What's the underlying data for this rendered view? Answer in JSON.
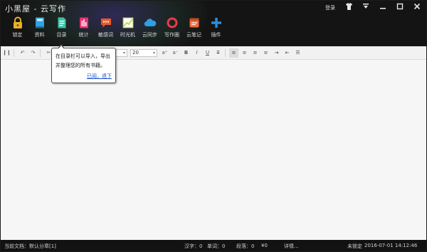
{
  "app": {
    "title": "小黑屋 - 云写作",
    "login_label": "登录"
  },
  "window_controls": [
    "shirt-icon",
    "minimize-icon",
    "restore-icon",
    "close-icon"
  ],
  "ribbon": [
    {
      "id": "lock",
      "label": "锁定",
      "icon": "lock-icon",
      "color": "#e8b12b"
    },
    {
      "id": "material",
      "label": "资料",
      "icon": "book-icon",
      "color": "#2fa3e0"
    },
    {
      "id": "catalog",
      "label": "目录",
      "icon": "document-icon",
      "color": "#3cc1a2"
    },
    {
      "id": "stats",
      "label": "统计",
      "icon": "stats-icon",
      "color": "#e8336e"
    },
    {
      "id": "sensitive",
      "label": "敏感词",
      "icon": "chat-icon",
      "color": "#e8592b"
    },
    {
      "id": "timemachine",
      "label": "时光机",
      "icon": "chart-icon",
      "color": "#b7d33a"
    },
    {
      "id": "cloudsync",
      "label": "云同步",
      "icon": "cloud-icon",
      "color": "#2e9fe0"
    },
    {
      "id": "writing",
      "label": "写作圈",
      "icon": "ring-icon",
      "color": "#e83b48"
    },
    {
      "id": "cloudnote",
      "label": "云笔记",
      "icon": "note-icon",
      "color": "#f06a3c"
    },
    {
      "id": "plugin",
      "label": "插件",
      "icon": "plus-icon",
      "color": "#2c8fe0"
    }
  ],
  "toolbar": {
    "font_value": "",
    "size_value": "20"
  },
  "tooltip": {
    "line1": "在目录栏可以导入，导出",
    "line2": "并整理您的所有书籍。",
    "link": "已阅，退下"
  },
  "status": {
    "doc": "当前文档：默认分章[1]",
    "chars": "汉字：0",
    "words": "单词：0",
    "paras": "段落：0",
    "money": "¥0",
    "details": "详情...",
    "lock": "未锁定",
    "datetime": "2016-07-01  14:12:46"
  }
}
